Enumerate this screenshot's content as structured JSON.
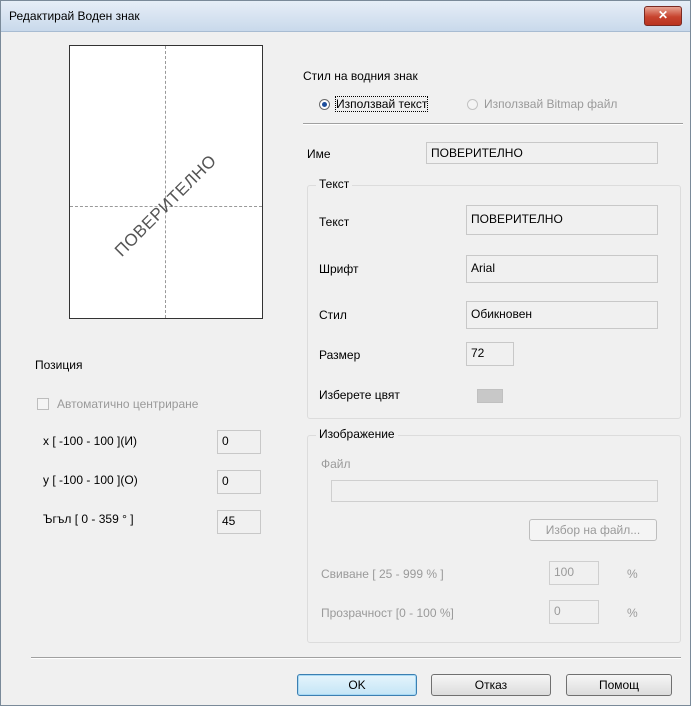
{
  "window": {
    "title": "Редактирай Воден знак",
    "close_label": "✕"
  },
  "preview": {
    "watermark_text": "ПОВЕРИТЕЛНО"
  },
  "position": {
    "heading": "Позиция",
    "auto_center_label": "Автоматично центриране",
    "auto_center_checked": false,
    "x_label": "x [ -100  -  100 ](И)",
    "x_value": "0",
    "y_label": "y [ -100  -  100 ](О)",
    "y_value": "0",
    "angle_label": "Ъгъл [ 0 - 359 ° ]",
    "angle_value": "45"
  },
  "style": {
    "heading": "Стил на водния знак",
    "use_text_label": "Използвай текст",
    "use_bitmap_label": "Използвай Bitmap файл",
    "selected": "text"
  },
  "name": {
    "label": "Име",
    "value": "ПОВЕРИТЕЛНО"
  },
  "text_group": {
    "title": "Текст",
    "text_label": "Текст",
    "text_value": "ПОВЕРИТЕЛНО",
    "font_label": "Шрифт",
    "font_value": "Arial",
    "style_label": "Стил",
    "style_value": "Обикновен",
    "size_label": "Размер",
    "size_value": "72",
    "color_label": "Изберете цвят",
    "color_value": "#c8c8c8"
  },
  "image_group": {
    "title": "Изображение",
    "file_label": "Файл",
    "file_value": "",
    "browse_label": "Избор на файл...",
    "scale_label": "Свиване [ 25 - 999 % ]",
    "scale_value": "100",
    "scale_unit": "%",
    "transparency_label": "Прозрачност [0 - 100 %]",
    "transparency_value": "0",
    "transparency_unit": "%"
  },
  "buttons": {
    "ok": "OK",
    "cancel": "Отказ",
    "help": "Помощ"
  }
}
